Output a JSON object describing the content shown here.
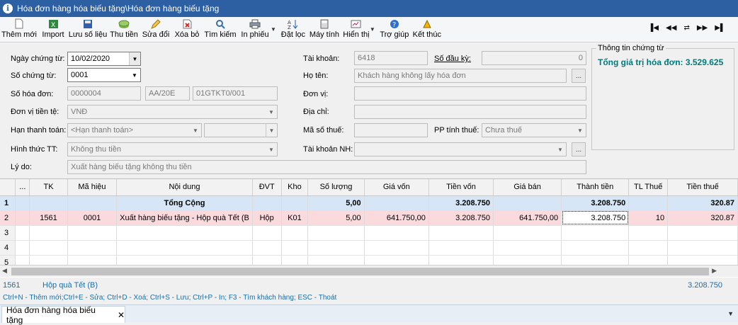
{
  "window": {
    "title": "Hóa đơn hàng hóa biếu tặng\\Hóa đơn hàng biếu tặng",
    "icon": "info-icon"
  },
  "toolbar": {
    "buttons": [
      {
        "label": "Thêm mới",
        "icon": "new-document-icon"
      },
      {
        "label": "Import",
        "icon": "excel-icon"
      },
      {
        "label": "Lưu số liệu",
        "icon": "save-icon"
      },
      {
        "label": "Thu tiền",
        "icon": "money-icon"
      },
      {
        "label": "Sửa đổi",
        "icon": "edit-icon"
      },
      {
        "label": "Xóa bỏ",
        "icon": "delete-icon"
      },
      {
        "label": "Tìm kiếm",
        "icon": "search-icon"
      },
      {
        "label": "In phiếu",
        "icon": "printer-icon"
      },
      {
        "label": "Đặt lọc",
        "icon": "sort-filter-icon"
      },
      {
        "label": "Máy tính",
        "icon": "calculator-icon"
      },
      {
        "label": "Hiển thị",
        "icon": "display-icon"
      },
      {
        "label": "Trợ giúp",
        "icon": "help-icon"
      },
      {
        "label": "Kết thúc",
        "icon": "exit-icon"
      }
    ],
    "nav": [
      "first-icon",
      "prev-icon",
      "refresh-icon",
      "next-icon",
      "last-icon"
    ]
  },
  "form": {
    "ngay_chung_tu": {
      "label": "Ngày chứng từ:",
      "value": "10/02/2020"
    },
    "so_chung_tu": {
      "label": "Số chứng từ:",
      "value": "0001"
    },
    "so_hoa_don": {
      "label": "Số hóa đơn:",
      "value": "0000004",
      "ky_hieu": "AA/20E",
      "mau_so": "01GTKT0/001"
    },
    "don_vi_tien_te": {
      "label": "Đơn vị tiền tệ:",
      "value": "VNĐ"
    },
    "han_thanh_toan": {
      "label": "Hạn thanh toán:",
      "value": "<Hạn thanh toán>",
      "value2": ""
    },
    "hinh_thuc_tt": {
      "label": "Hình thức TT:",
      "value": "Không thu tiền"
    },
    "ly_do": {
      "label": "Lý do:",
      "value": "Xuất hàng biếu tặng không thu tiền"
    },
    "tai_khoan": {
      "label": "Tài khoản:",
      "value": "6418"
    },
    "so_dau_ky": {
      "label": "Số đầu kỳ:",
      "value": "0"
    },
    "ho_ten": {
      "label": "Họ tên:",
      "value": "Khách hàng không lấy hóa đơn"
    },
    "don_vi": {
      "label": "Đơn vị:",
      "value": ""
    },
    "dia_chi": {
      "label": "Địa chỉ:",
      "value": ""
    },
    "ma_so_thue": {
      "label": "Mã số thuế:",
      "value": ""
    },
    "pp_tinh_thue": {
      "label": "PP tính thuế:",
      "value": "Chưa thuế"
    },
    "tai_khoan_nh": {
      "label": "Tài khoản NH:",
      "value": ""
    }
  },
  "info": {
    "legend": "Thông tin chứng từ",
    "total_label": "Tổng giá trị hóa đơn:",
    "total_value": "3.529.625"
  },
  "grid": {
    "columns": [
      "...",
      "TK",
      "Mã hiệu",
      "Nội dung",
      "ĐVT",
      "Kho",
      "Số lượng",
      "Giá vốn",
      "Tiền vốn",
      "Giá bán",
      "Thành tiền",
      "TL Thuế",
      "Tiền thuế"
    ],
    "total_row": {
      "rn": "1",
      "label": "Tổng Cộng",
      "so_luong": "5,00",
      "tien_von": "3.208.750",
      "thanh_tien": "3.208.750",
      "tien_thue": "320.87"
    },
    "rows": [
      {
        "rn": "2",
        "tk": "1561",
        "ma_hieu": "0001",
        "noi_dung": "Xuất hàng biếu tặng - Hộp quà Tết (B",
        "dvt": "Hộp",
        "kho": "K01",
        "so_luong": "5,00",
        "gia_von": "641.750,00",
        "tien_von": "3.208.750",
        "gia_ban": "641.750,00",
        "thanh_tien": "3.208.750",
        "tl_thue": "10",
        "tien_thue": "320.87"
      },
      {
        "rn": "3"
      },
      {
        "rn": "4"
      },
      {
        "rn": "5"
      }
    ]
  },
  "status": {
    "account": "1561",
    "item_name": "Hộp quà Tết (B)",
    "amount": "3.208.750",
    "shortcuts": "Ctrl+N - Thêm mới;Ctrl+E - Sửa; Ctrl+D - Xoá; Ctrl+S - Lưu; Ctrl+P - In; F3 - Tìm khách hàng; ESC - Thoát"
  },
  "tabs": [
    {
      "label": "Hóa đơn hàng hóa biếu tặng"
    }
  ]
}
